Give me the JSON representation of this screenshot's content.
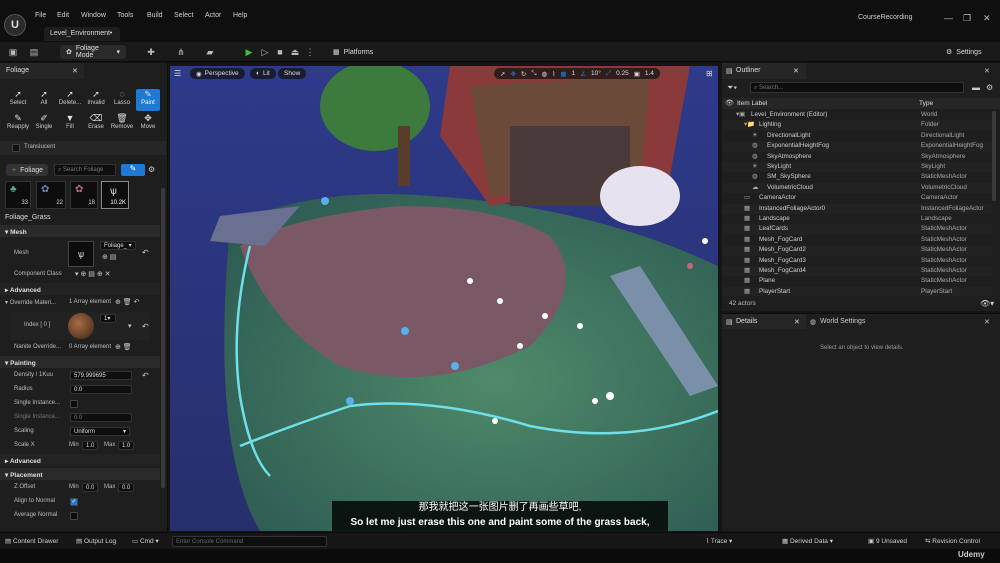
{
  "menubar": {
    "logo": "U",
    "items": [
      "File",
      "Edit",
      "Window",
      "Tools",
      "Build",
      "Select",
      "Actor",
      "Help"
    ],
    "doc_tab": "Level_Environment•",
    "project_name": "CourseRecording"
  },
  "toolbar": {
    "mode_label": "Foliage Mode",
    "platforms_label": "Platforms",
    "settings_label": "Settings"
  },
  "foliage_panel": {
    "tab_label": "Foliage",
    "tools_row1": [
      "Select",
      "All",
      "Delete...",
      "Invalid",
      "Lasso",
      "Paint"
    ],
    "tools_row2": [
      "Reapply",
      "Single",
      "Fill",
      "Erase",
      "Remove",
      "Move"
    ],
    "translucent_label": "Translucent",
    "add_foliage_label": "Foliage",
    "search_placeholder": "Search Foliage",
    "thumbs": [
      "33",
      "22",
      "18",
      "10.2K"
    ],
    "selected_type": "Foliage_Grass",
    "sections": {
      "mesh": "Mesh",
      "advanced": "Advanced",
      "painting": "Painting",
      "advanced2": "Advanced",
      "placement": "Placement"
    },
    "mesh_label": "Mesh",
    "mesh_value": "Foliage_",
    "component_class_label": "Component Class",
    "override_materials_label": "Override Materi...",
    "override_materials_value": "1 Array element",
    "index_label": "Index [ 0 ]",
    "index_value": "1",
    "nanite_override_label": "Nanite Override...",
    "nanite_override_value": "0 Array element",
    "density_label": "Density / 1Kuu",
    "density_value": "579.999695",
    "radius_label": "Radius",
    "radius_value": "0.0",
    "single_instance_label": "Single Instance...",
    "single_instance2_label": "Single Instance...",
    "single_instance2_value": "0.0",
    "scaling_label": "Scaling",
    "scaling_value": "Uniform",
    "scale_x_label": "Scale X",
    "min_label": "Min",
    "min_value": "1.0",
    "max_label": "Max",
    "max_value": "1.0",
    "z_offset_label": "Z Offset",
    "z_min_value": "0.0",
    "z_max_value": "0.0",
    "align_normal_label": "Align to Normal",
    "average_normal_label": "Average Normal"
  },
  "viewport": {
    "perspective_label": "Perspective",
    "lit_label": "Lit",
    "show_label": "Show",
    "snap_angle": "10°",
    "snap_scale": "0.25",
    "camera_speed": "1.4",
    "grid_value": "1"
  },
  "subtitles": {
    "chinese": "那我就把这一张图片删了再画些草吧,",
    "english": "So let me just erase this one and paint some of the grass back,"
  },
  "outliner": {
    "tab_label": "Outliner",
    "search_placeholder": "Search...",
    "col_label": "Item Label",
    "col_type": "Type",
    "rows": [
      {
        "name": "Level_Environment (Editor)",
        "type": "World"
      },
      {
        "name": "Lighting",
        "type": "Folder"
      },
      {
        "name": "DirectionalLight",
        "type": "DirectionalLight"
      },
      {
        "name": "ExponentialHeightFog",
        "type": "ExponentialHeightFog"
      },
      {
        "name": "SkyAtmosphere",
        "type": "SkyAtmosphere"
      },
      {
        "name": "SkyLight",
        "type": "SkyLight"
      },
      {
        "name": "SM_SkySphere",
        "type": "StaticMeshActor"
      },
      {
        "name": "VolumetricCloud",
        "type": "VolumetricCloud"
      },
      {
        "name": "CameraActor",
        "type": "CameraActor"
      },
      {
        "name": "InstancedFoliageActor0",
        "type": "InstancedFoliageActor"
      },
      {
        "name": "Landscape",
        "type": "Landscape"
      },
      {
        "name": "LeafCards",
        "type": "StaticMeshActor"
      },
      {
        "name": "Mesh_FogCard",
        "type": "StaticMeshActor"
      },
      {
        "name": "Mesh_FogCard2",
        "type": "StaticMeshActor"
      },
      {
        "name": "Mesh_FogCard3",
        "type": "StaticMeshActor"
      },
      {
        "name": "Mesh_FogCard4",
        "type": "StaticMeshActor"
      },
      {
        "name": "Plane",
        "type": "StaticMeshActor"
      },
      {
        "name": "PlayerStart",
        "type": "PlayerStart"
      }
    ],
    "actor_count": "42 actors"
  },
  "details": {
    "tab_label": "Details",
    "world_settings_label": "World Settings",
    "empty_message": "Select an object to view details."
  },
  "statusbar": {
    "content_drawer": "Content Drawer",
    "output_log": "Output Log",
    "cmd": "Cmd",
    "console_placeholder": "Enter Console Command",
    "trace": "Trace",
    "derived_data": "Derived Data",
    "unsaved": "9 Unsaved",
    "revision_control": "Revision Control"
  },
  "watermark": "Udemy",
  "colors": {
    "accent": "#1f7ad6",
    "play_green": "#3fbf3f",
    "panel_bg": "#1e1e1e"
  }
}
